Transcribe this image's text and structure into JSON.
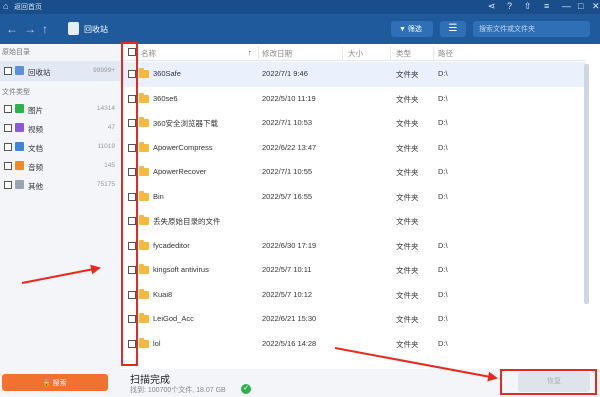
{
  "titlebar": {
    "back_label": "返回首页"
  },
  "toolbar": {
    "breadcrumb": "回收站",
    "filter_label": "筛选",
    "search_placeholder": "搜索文件或文件夹"
  },
  "sidebar": {
    "section1": "原始目录",
    "section2": "文件类型",
    "items": [
      {
        "label": "回收站",
        "count": "99999+"
      },
      {
        "label": "图片",
        "count": "14314"
      },
      {
        "label": "视频",
        "count": "47"
      },
      {
        "label": "文档",
        "count": "11019"
      },
      {
        "label": "音频",
        "count": "145"
      },
      {
        "label": "其他",
        "count": "75175"
      }
    ],
    "scan_button": "搜索"
  },
  "table": {
    "headers": {
      "name": "名称",
      "sort": "↑",
      "date": "修改日期",
      "size": "大小",
      "type": "类型",
      "path": "路径"
    },
    "rows": [
      {
        "name": "360Safe",
        "date": "2022/7/1 9:46",
        "type": "文件夹",
        "path": "D:\\"
      },
      {
        "name": "360se6",
        "date": "2022/5/10 11:19",
        "type": "文件夹",
        "path": "D:\\"
      },
      {
        "name": "360安全浏览器下载",
        "date": "2022/7/1 10:53",
        "type": "文件夹",
        "path": "D:\\"
      },
      {
        "name": "ApowerCompress",
        "date": "2022/6/22 13:47",
        "type": "文件夹",
        "path": "D:\\"
      },
      {
        "name": "ApowerRecover",
        "date": "2022/7/1 10:55",
        "type": "文件夹",
        "path": "D:\\"
      },
      {
        "name": "Bin",
        "date": "2022/5/7 16:55",
        "type": "文件夹",
        "path": "D:\\"
      },
      {
        "name": "丢失原始目录的文件",
        "date": "",
        "type": "文件夹",
        "path": ""
      },
      {
        "name": "fycadeditor",
        "date": "2022/6/30 17:19",
        "type": "文件夹",
        "path": "D:\\"
      },
      {
        "name": "kingsoft antivirus",
        "date": "2022/5/7 10:11",
        "type": "文件夹",
        "path": "D:\\"
      },
      {
        "name": "Kuai8",
        "date": "2022/5/7 10:12",
        "type": "文件夹",
        "path": "D:\\"
      },
      {
        "name": "LeiGod_Acc",
        "date": "2022/6/21 15:30",
        "type": "文件夹",
        "path": "D:\\"
      },
      {
        "name": "lol",
        "date": "2022/5/16 14:28",
        "type": "文件夹",
        "path": "D:\\"
      }
    ]
  },
  "footer": {
    "status": "扫描完成",
    "summary": "找到: 100700个文件, 18.07 GB",
    "recover_button": "恢复"
  },
  "colors": {
    "accent": "#1e5a9c",
    "orange": "#f3712f",
    "annotation": "#e8281e"
  }
}
